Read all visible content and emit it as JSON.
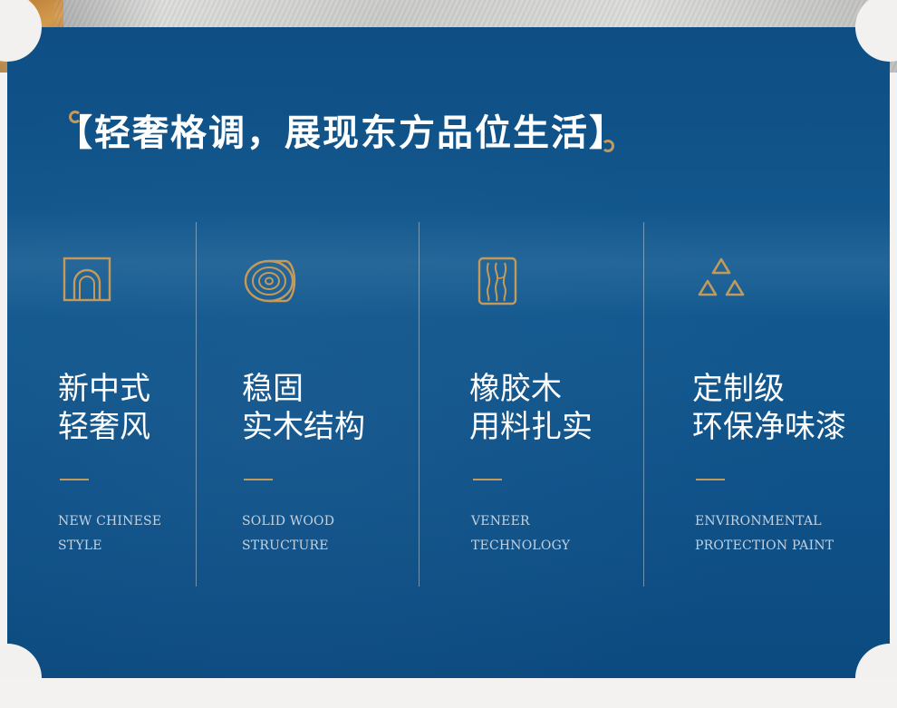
{
  "header": {
    "open_bracket": "【",
    "title": "轻奢格调，展现东方品位生活",
    "close_bracket": "】"
  },
  "colors": {
    "panel_blue": "#0f5289",
    "accent_gold": "#c49a5a",
    "text_white": "#ffffff"
  },
  "features": [
    {
      "icon": "arch-icon",
      "title_line1": "新中式",
      "title_line2": "轻奢风",
      "en_line1": "NEW CHINESE",
      "en_line2": "STYLE"
    },
    {
      "icon": "wood-log-icon",
      "title_line1": "稳固",
      "title_line2": "实木结构",
      "en_line1": "SOLID WOOD",
      "en_line2": "STRUCTURE"
    },
    {
      "icon": "wood-grain-icon",
      "title_line1": "橡胶木",
      "title_line2": "用料扎实",
      "en_line1": "VENEER",
      "en_line2": "TECHNOLOGY"
    },
    {
      "icon": "recycle-triangles-icon",
      "title_line1": "定制级",
      "title_line2": "环保净味漆",
      "en_line1": "ENVIRONMENTAL",
      "en_line2": "PROTECTION PAINT"
    }
  ]
}
